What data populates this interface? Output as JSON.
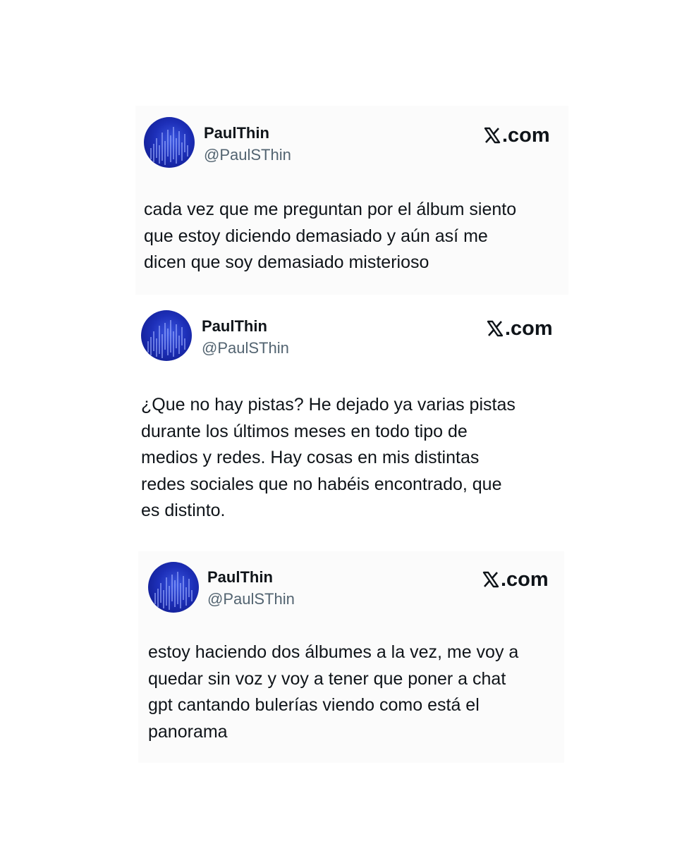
{
  "tweets": [
    {
      "display_name": "PaulThin",
      "handle": "@PaulSThin",
      "source": "X.com",
      "source_suffix": ".com",
      "avatar": "avatar-blue-waveform",
      "text_lines": [
        "cada vez que me preguntan por el álbum siento",
        "que estoy diciendo demasiado y aún así me",
        "dicen que soy demasiado misterioso"
      ]
    },
    {
      "display_name": "PaulThin",
      "handle": "@PaulSThin",
      "source": "X.com",
      "source_suffix": ".com",
      "avatar": "avatar-blue-waveform",
      "text_lines": [
        "¿Que no hay pistas? He dejado ya varias pistas",
        "durante los últimos meses en todo tipo de",
        "medios y redes. Hay cosas en mis distintas",
        "redes sociales que no habéis encontrado, que",
        "es distinto."
      ]
    },
    {
      "display_name": "PaulThin",
      "handle": "@PaulSThin",
      "source": "X.com",
      "source_suffix": ".com",
      "avatar": "avatar-blue-waveform",
      "text_lines": [
        "estoy haciendo dos álbumes a la vez, me voy a",
        "quedar sin voz y voy a tener que poner a chat",
        "gpt cantando bulerías viendo como está el",
        "panorama"
      ]
    }
  ],
  "colors": {
    "text": "#0f1419",
    "handle": "#536471",
    "card_background": "#fbfbfb",
    "avatar_blue": "#1d2fb8"
  }
}
